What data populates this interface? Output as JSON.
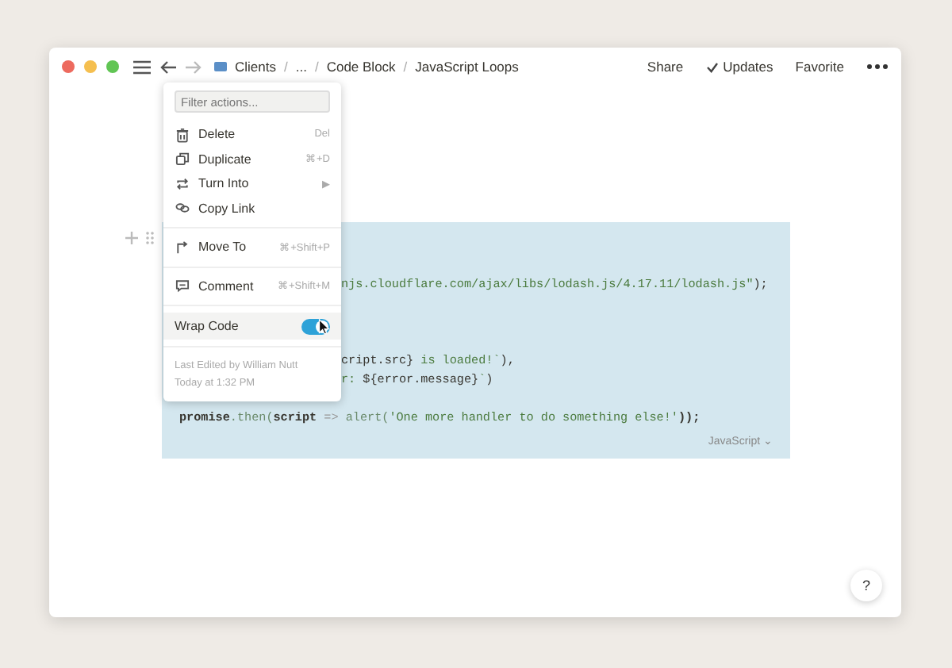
{
  "breadcrumbs": [
    "Clients",
    "...",
    "Code Block",
    "JavaScript Loops"
  ],
  "breadcrumb_separator": "/",
  "topbar_actions": [
    {
      "label": "Share",
      "kind": "text"
    },
    {
      "label": "Updates",
      "kind": "check"
    },
    {
      "label": "Favorite",
      "kind": "text"
    }
  ],
  "code_block": {
    "lines": [
      {
        "kind": "blank"
      },
      {
        "kind": "blank"
      },
      {
        "kind": "partial",
        "segments": [
          {
            "kind": "string",
            "text": "njs.cloudflare.com/ajax/libs/lodash.js/4.17.11/lodash.js\""
          },
          {
            "kind": "plain",
            "text": ");"
          }
        ]
      },
      {
        "kind": "blank"
      },
      {
        "kind": "blank"
      },
      {
        "kind": "blank"
      },
      {
        "kind": "partial",
        "segments": [
          {
            "kind": "plain",
            "text": "cript.src}"
          },
          {
            "kind": "string",
            "text": " is loaded!`"
          },
          {
            "kind": "plain",
            "text": "),"
          }
        ]
      },
      {
        "kind": "partial",
        "segments": [
          {
            "kind": "string",
            "text": "r: "
          },
          {
            "kind": "plain",
            "text": "${error.message}"
          },
          {
            "kind": "string",
            "text": "`"
          },
          {
            "kind": "plain",
            "text": ")"
          }
        ]
      },
      {
        "kind": "blank"
      },
      {
        "kind": "full",
        "segments": [
          {
            "kind": "plain",
            "text": "promise"
          },
          {
            "kind": "method",
            "text": ".then("
          },
          {
            "kind": "plain",
            "text": "script "
          },
          {
            "kind": "operator",
            "text": "=>"
          },
          {
            "kind": "method",
            "text": " alert("
          },
          {
            "kind": "string",
            "text": "'One more handler to do something else!'"
          },
          {
            "kind": "plain",
            "text": "));"
          }
        ]
      }
    ],
    "language": "JavaScript",
    "language_caret": "⌄"
  },
  "menu": {
    "filter": {
      "placeholder": "Filter actions..."
    },
    "items": [
      {
        "kind": "action",
        "label": "Delete",
        "shortcut": "Del"
      },
      {
        "kind": "action",
        "label": "Duplicate",
        "shortcut": "⌘+D"
      },
      {
        "kind": "action",
        "label": "Turn Into",
        "shortcut": "▶"
      },
      {
        "kind": "action",
        "label": "Copy Link"
      },
      {
        "kind": "divider"
      },
      {
        "kind": "action",
        "label": "Move To",
        "shortcut": "⌘+Shift+P"
      },
      {
        "kind": "divider"
      },
      {
        "kind": "action",
        "label": "Comment",
        "shortcut": "⌘+Shift+M"
      },
      {
        "kind": "divider"
      },
      {
        "kind": "toggle",
        "label": "Wrap Code",
        "on": true
      },
      {
        "kind": "divider"
      }
    ],
    "footer": [
      "Last Edited by William Nutt",
      "Today at 1:32 PM"
    ]
  },
  "help": "?"
}
